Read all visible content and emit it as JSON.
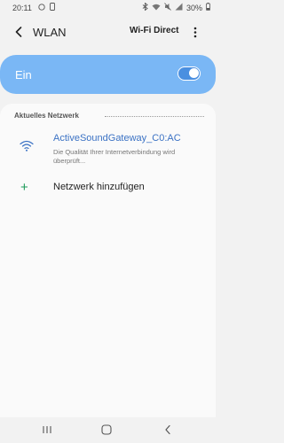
{
  "status_bar": {
    "time": "20:11",
    "left_icons": [
      "whatsapp-icon",
      "phone-icon"
    ],
    "right_icons": [
      "bluetooth-icon",
      "wifi-icon",
      "mute-icon",
      "signal-icon"
    ],
    "battery": "30%"
  },
  "app_bar": {
    "title": "WLAN",
    "wifi_direct_label": "Wi-Fi Direct"
  },
  "toggle": {
    "label": "Ein",
    "state": "on",
    "accent_color": "#7ab7f5"
  },
  "current_network": {
    "section_title": "Aktuelles Netzwerk",
    "name": "ActiveSoundGateway_C0:AC",
    "status": "Die Qualität Ihrer Internetverbindung wird überprüft..."
  },
  "add_network": {
    "label": "Netzwerk hinzufügen"
  },
  "nav_bar": {
    "buttons": [
      "recent-apps",
      "home",
      "back"
    ]
  }
}
